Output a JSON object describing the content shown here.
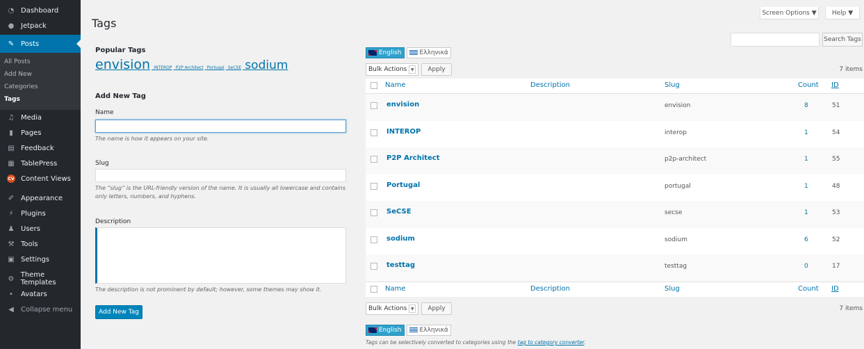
{
  "sidebar": {
    "items": [
      {
        "label": "Dashboard",
        "icon": "dashboard-icon"
      },
      {
        "label": "Jetpack",
        "icon": "jetpack-icon"
      },
      {
        "label": "Posts",
        "icon": "pin-icon"
      },
      {
        "label": "Media",
        "icon": "media-icon"
      },
      {
        "label": "Pages",
        "icon": "pages-icon"
      },
      {
        "label": "Feedback",
        "icon": "feedback-icon"
      },
      {
        "label": "TablePress",
        "icon": "table-icon"
      },
      {
        "label": "Content Views",
        "icon": "cv-icon",
        "badge": "CV"
      },
      {
        "label": "Appearance",
        "icon": "brush-icon"
      },
      {
        "label": "Plugins",
        "icon": "plugin-icon"
      },
      {
        "label": "Users",
        "icon": "users-icon"
      },
      {
        "label": "Tools",
        "icon": "wrench-icon"
      },
      {
        "label": "Settings",
        "icon": "settings-icon"
      },
      {
        "label": "Theme Templates",
        "icon": "gear-icon"
      },
      {
        "label": "Avatars",
        "icon": "avatar-icon"
      },
      {
        "label": "Collapse menu",
        "icon": "collapse-icon"
      }
    ],
    "posts_sub": [
      "All Posts",
      "Add New",
      "Categories",
      "Tags"
    ]
  },
  "top": {
    "screen_options": "Screen Options ▼",
    "help": "Help ▼"
  },
  "title": "Tags",
  "search": {
    "button": "Search Tags",
    "placeholder": ""
  },
  "left": {
    "popular_heading": "Popular Tags",
    "cloud": [
      {
        "tag": "envision"
      },
      {
        "tag": "INTEROP"
      },
      {
        "tag": "P2P Architect"
      },
      {
        "tag": "Portugal"
      },
      {
        "tag": "SeCSE"
      },
      {
        "tag": "sodium"
      }
    ],
    "add_heading": "Add New Tag",
    "name_label": "Name",
    "name_help": "The name is how it appears on your site.",
    "slug_label": "Slug",
    "slug_help": "The “slug” is the URL-friendly version of the name. It is usually all lowercase and contains only letters, numbers, and hyphens.",
    "desc_label": "Description",
    "desc_help": "The description is not prominent by default; however, some themes may show it.",
    "add_button": "Add New Tag"
  },
  "lang": {
    "english": "English",
    "greek": "Ελληνικά"
  },
  "bulk": {
    "select": "Bulk Actions",
    "apply": "Apply",
    "count": "7 items"
  },
  "table": {
    "headers": {
      "name": "Name",
      "description": "Description",
      "slug": "Slug",
      "count": "Count",
      "id": "ID"
    },
    "rows": [
      {
        "name": "envision",
        "slug": "envision",
        "count": "8",
        "id": "51"
      },
      {
        "name": "INTEROP",
        "slug": "interop",
        "count": "1",
        "id": "54"
      },
      {
        "name": "P2P Architect",
        "slug": "p2p-architect",
        "count": "1",
        "id": "55"
      },
      {
        "name": "Portugal",
        "slug": "portugal",
        "count": "1",
        "id": "48"
      },
      {
        "name": "SeCSE",
        "slug": "secse",
        "count": "1",
        "id": "53"
      },
      {
        "name": "sodium",
        "slug": "sodium",
        "count": "6",
        "id": "52"
      },
      {
        "name": "testtag",
        "slug": "testtag",
        "count": "0",
        "id": "17"
      }
    ]
  },
  "note": {
    "text": "Tags can be selectively converted to categories using the ",
    "link": "tag to category converter",
    "end": "."
  }
}
